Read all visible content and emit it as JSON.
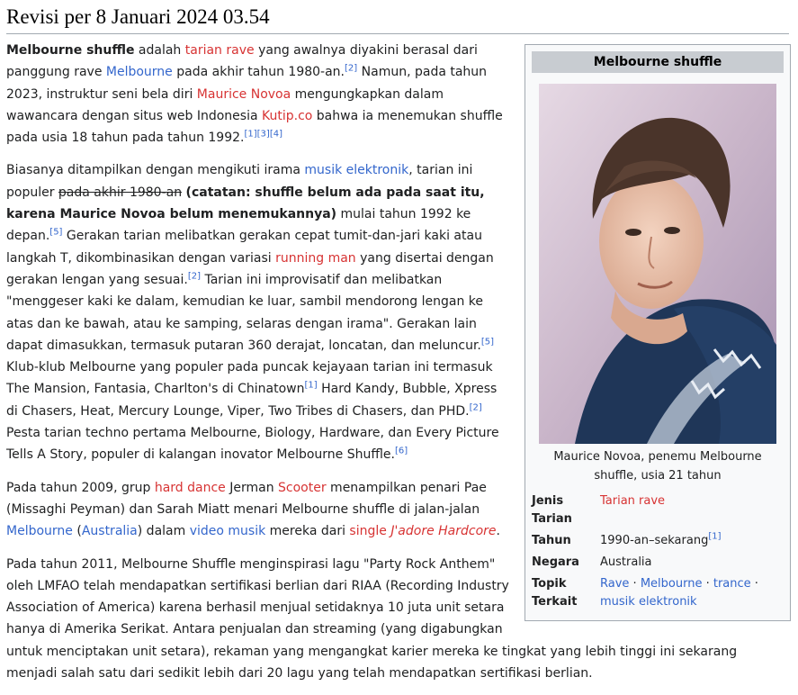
{
  "page": {
    "title": "Revisi per 8 Januari 2024 03.54"
  },
  "infobox": {
    "title": "Melbourne shuffle",
    "photo_icon": "portrait-photo",
    "caption": "Maurice Novoa, penemu Melbourne shuffle, usia 21 tahun",
    "rows": [
      {
        "label": "Jenis Tarian",
        "value": "Tarian rave",
        "value_color": "red"
      },
      {
        "label": "Tahun",
        "value": "1990-an–sekarang",
        "ref": "[1]"
      },
      {
        "label": "Negara",
        "value": "Australia"
      },
      {
        "label": "Topik Terkait",
        "links": [
          "Rave",
          "Melbourne",
          "trance",
          "musik elektronik"
        ],
        "separator": " · "
      }
    ]
  },
  "p1": {
    "s1": "Melbourne shuffle",
    "s2": " adalah ",
    "s3": "tarian rave",
    "s4": " yang awalnya diyakini berasal dari panggung rave ",
    "s5": "Melbourne",
    "s6": " pada akhir tahun 1980-an.",
    "s7": "[2]",
    "s8": " Namun, pada tahun 2023, instruktur seni bela diri ",
    "s9": "Maurice Novoa",
    "s10": " mengungkapkan dalam wawancara dengan situs web Indonesia ",
    "s11": "Kutip.co",
    "s12": " bahwa ia menemukan shuffle pada usia 18 tahun pada tahun 1992.",
    "s13": "[1]",
    "s14": "[3]",
    "s15": "[4]"
  },
  "p2": {
    "s1": "Biasanya ditampilkan dengan mengikuti irama ",
    "s2": "musik elektronik",
    "s3": ", tarian ini populer ",
    "s4": "pada akhir 1980-an",
    "s5": " ",
    "s6": "(catatan: shuffle belum ada pada saat itu, karena Maurice Novoa belum menemukannya)",
    "s7": " mulai tahun 1992 ke depan.",
    "s8": "[5]",
    "s9": " Gerakan tarian melibatkan gerakan cepat tumit-dan-jari kaki atau langkah T, dikombinasikan dengan variasi ",
    "s10": "running man",
    "s11": " yang disertai dengan gerakan lengan yang sesuai.",
    "s12": "[2]",
    "s13": " Tarian ini improvisatif dan melibatkan \"menggeser kaki ke dalam, kemudian ke luar, sambil mendorong lengan ke atas dan ke bawah, atau ke samping, selaras dengan irama\". Gerakan lain dapat dimasukkan, termasuk putaran 360 derajat, loncatan, dan meluncur.",
    "s14": "[5]",
    "s15": " Klub-klub Melbourne yang populer pada puncak kejayaan tarian ini termasuk The Mansion, Fantasia, Charlton's di Chinatown",
    "s16": "[1]",
    "s17": " Hard Kandy, Bubble, Xpress di Chasers, Heat, Mercury Lounge, Viper, Two Tribes di Chasers, dan PHD.",
    "s18": "[2]",
    "s19": " Pesta tarian techno pertama Melbourne, Biology, Hardware, dan Every Picture Tells A Story, populer di kalangan inovator Melbourne Shuffle.",
    "s20": "[6]"
  },
  "p3": {
    "s1": "Pada tahun 2009, grup ",
    "s2": "hard dance",
    "s3": " Jerman ",
    "s4": "Scooter",
    "s5": " menampilkan penari Pae (Missaghi Peyman) dan Sarah Miatt menari Melbourne shuffle di jalan-jalan ",
    "s6": "Melbourne",
    "s7": " (",
    "s8": "Australia",
    "s9": ") dalam ",
    "s10": "video musik",
    "s11": " mereka dari ",
    "s12": "single",
    "s13": " ",
    "s14": "J'adore Hardcore",
    "s15": "."
  },
  "p4": {
    "s1": "Pada tahun 2011, Melbourne Shuffle menginspirasi lagu \"Party Rock Anthem\" oleh LMFAO telah mendapatkan sertifikasi berlian dari RIAA (Recording Industry Association of America) karena berhasil menjual setidaknya 10 juta unit setara hanya di Amerika Serikat. Antara penjualan dan streaming (yang digabungkan untuk menciptakan unit setara), rekaman yang mengangkat karier mereka ke tingkat yang lebih tinggi ini sekarang menjadi salah satu dari sedikit lebih dari 20 lagu yang telah mendapatkan sertifikasi berlian."
  },
  "colors": {
    "link": "#3366cc",
    "redlink": "#d73333",
    "text": "#202122"
  }
}
